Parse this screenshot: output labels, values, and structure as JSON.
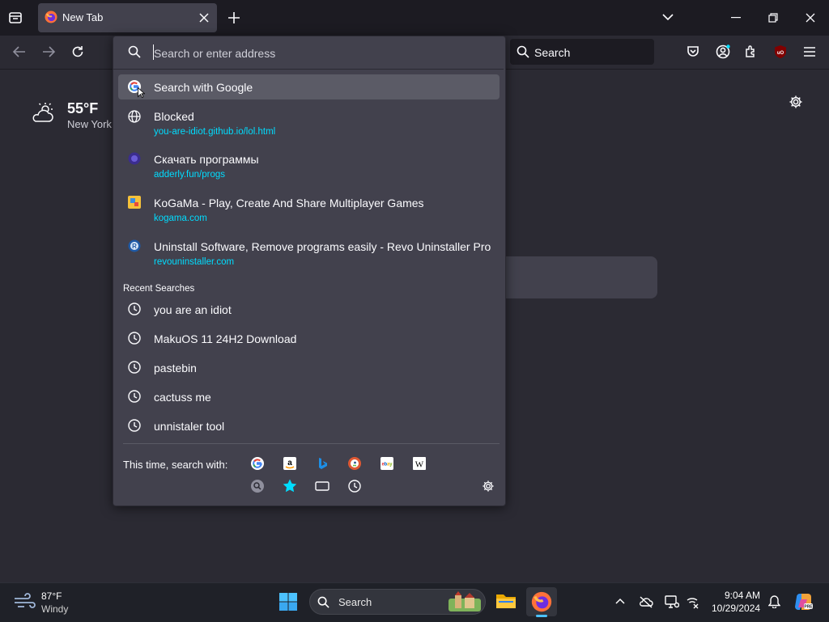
{
  "browser": {
    "tab_title": "New Tab",
    "search_placeholder": "Search"
  },
  "urlbar": {
    "placeholder": "Search or enter address",
    "value": ""
  },
  "weather": {
    "temperature": "55°F",
    "location": "New York"
  },
  "suggestions": [
    {
      "title": "Search with Google",
      "icon": "google-icon"
    },
    {
      "title": "Blocked",
      "url": "you-are-idiot.github.io/lol.html",
      "icon": "globe-icon"
    },
    {
      "title": "Скачать программы",
      "url": "adderly.fun/progs",
      "icon": "site-icon"
    },
    {
      "title": "KoGaMa - Play, Create And Share Multiplayer Games",
      "url": "kogama.com",
      "icon": "kogama-icon"
    },
    {
      "title": "Uninstall Software, Remove programs easily - Revo Uninstaller Pro",
      "url": "revouninstaller.com",
      "icon": "revo-icon"
    }
  ],
  "recent_searches": {
    "header": "Recent Searches",
    "items": [
      "you are an idiot",
      "MakuOS 11 24H2 Download",
      "pastebin",
      "cactuss me",
      "unnistaler tool"
    ]
  },
  "search_with": {
    "label": "This time, search with:",
    "engines": [
      "google-icon",
      "amazon-icon",
      "bing-icon",
      "duckduckgo-icon",
      "ebay-icon",
      "wikipedia-icon"
    ],
    "modes": [
      "search-engine-icon",
      "bookmarks-star-icon",
      "tabs-icon",
      "history-icon"
    ]
  },
  "taskbar": {
    "weather_temp": "87°F",
    "weather_cond": "Windy",
    "search_label": "Search",
    "time": "9:04 AM",
    "date": "10/29/2024"
  },
  "colors": {
    "accent_url": "#00ddff",
    "panel": "#42414d",
    "highlight": "#5b5b66",
    "background": "#2b2a33"
  }
}
